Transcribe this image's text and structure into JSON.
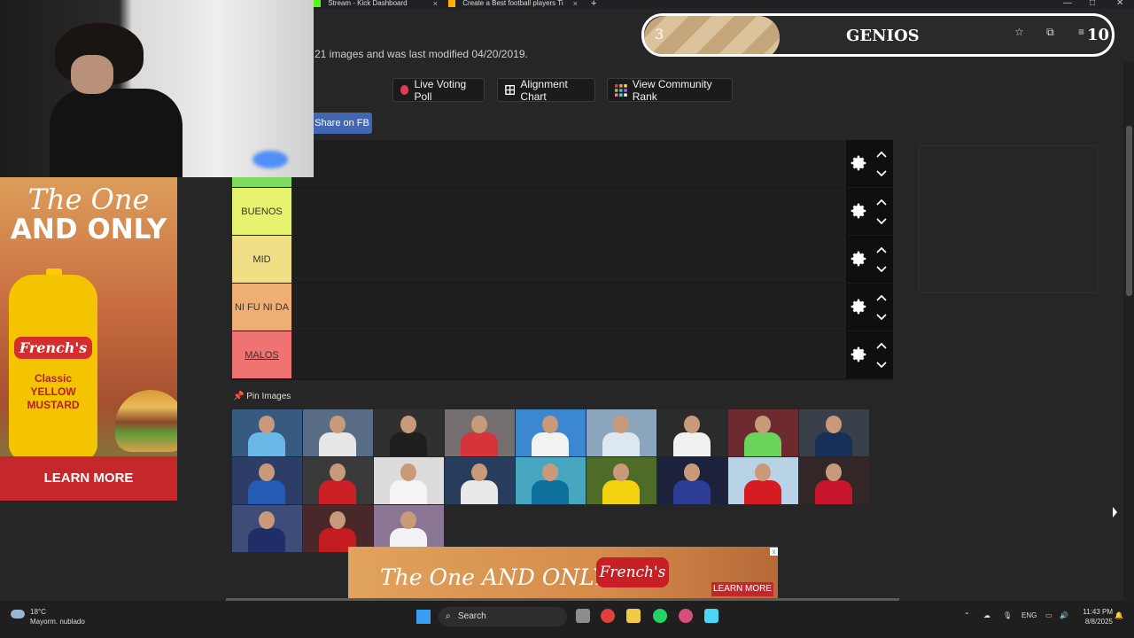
{
  "browser": {
    "tabs": [
      {
        "title": "Stream - Kick Dashboard"
      },
      {
        "title": "Create a Best football players Ti"
      }
    ],
    "window_controls": [
      "—",
      "□",
      "✕"
    ]
  },
  "page": {
    "subtitle": "21 images and was last modified 04/20/2019.",
    "buttons": {
      "live_voting": "Live Voting Poll",
      "alignment_chart": "Alignment Chart",
      "community_rank": "View Community Rank",
      "share_fb": "Share on FB"
    },
    "tiers": [
      {
        "label": "",
        "color": "#7ddc5b"
      },
      {
        "label": "BUENOS",
        "color": "#e7f26f"
      },
      {
        "label": "MID",
        "color": "#f0df84"
      },
      {
        "label": "NI FU NI DA",
        "color": "#efae74"
      },
      {
        "label": "MALOS",
        "color": "#ef7373"
      }
    ],
    "pin_label": "Pin Images"
  },
  "players": [
    {
      "shirt": "#6bb8e8",
      "bg": "#365a80"
    },
    {
      "shirt": "#e6e6e6",
      "bg": "#596c85"
    },
    {
      "shirt": "#1f1f1f",
      "bg": "#303030"
    },
    {
      "shirt": "#d5343a",
      "bg": "#756f70"
    },
    {
      "shirt": "#f2f2f2",
      "bg": "#3b88d0"
    },
    {
      "shirt": "#dce7f0",
      "bg": "#8ba6bc"
    },
    {
      "shirt": "#f0f0f0",
      "bg": "#2b2b2b"
    },
    {
      "shirt": "#6bd25a",
      "bg": "#6e2b2f"
    },
    {
      "shirt": "#17305a",
      "bg": "#39404a"
    },
    {
      "shirt": "#235bb5",
      "bg": "#2c3d67"
    },
    {
      "shirt": "#cc2027",
      "bg": "#3a3a3a"
    },
    {
      "shirt": "#f4f4f4",
      "bg": "#dcdcdc"
    },
    {
      "shirt": "#e8e8e8",
      "bg": "#283c5e"
    },
    {
      "shirt": "#0d6f9b",
      "bg": "#47a6c0"
    },
    {
      "shirt": "#f3d20f",
      "bg": "#4f6b28"
    },
    {
      "shirt": "#2d3d96",
      "bg": "#1c213c"
    },
    {
      "shirt": "#d41c22",
      "bg": "#b8d2e6"
    },
    {
      "shirt": "#c7162b",
      "bg": "#332626"
    },
    {
      "shirt": "#1f2e66",
      "bg": "#3d4d78"
    },
    {
      "shirt": "#c31d22",
      "bg": "#482828"
    },
    {
      "shirt": "#f2f2f2",
      "bg": "#8a7594"
    }
  ],
  "ad_left": {
    "headline_1": "The One",
    "headline_2": "AND ONLY",
    "brand": "French's",
    "product": "Classic YELLOW MUSTARD",
    "cta": "LEARN MORE"
  },
  "scoreboard": {
    "left": "3",
    "title": "GENIOS",
    "right": "10",
    "progress": 0.29
  },
  "bottom_ad": {
    "headline": "The One AND ONLY",
    "brand": "French's",
    "cta": "LEARN MORE",
    "close": "x"
  },
  "taskbar": {
    "temperature": "18°C",
    "weather": "Mayorm. nublado",
    "search": "Search",
    "lang": "ENG",
    "time": "11:43 PM",
    "date": "8/8/2025"
  }
}
